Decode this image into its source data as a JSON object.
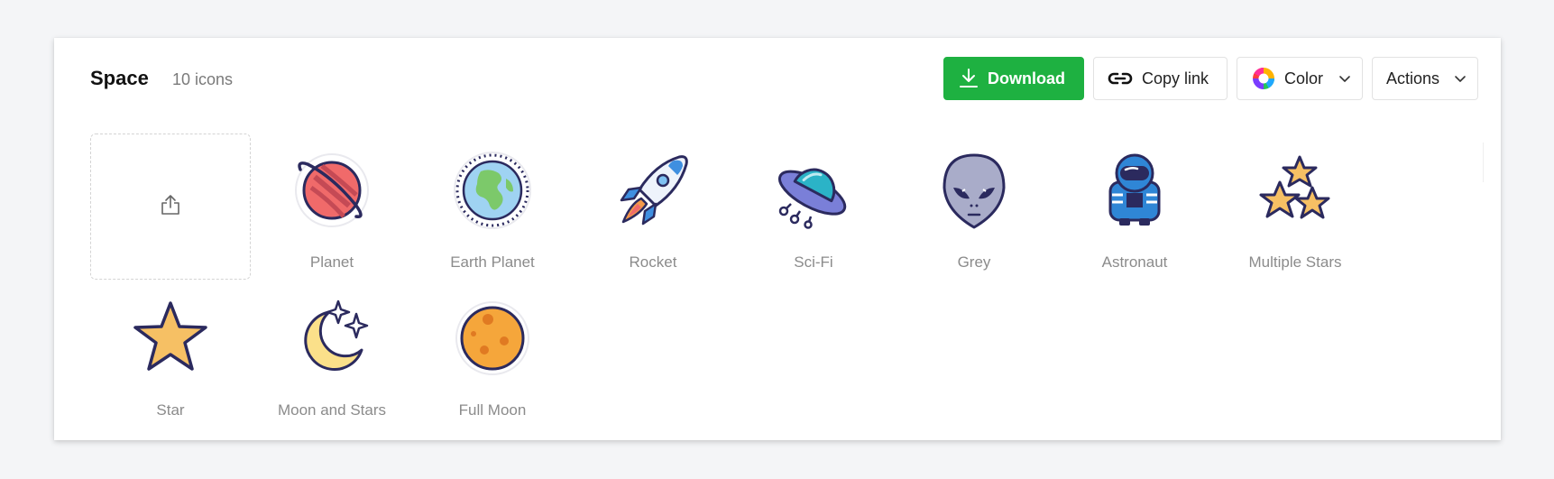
{
  "collection": {
    "title": "Space",
    "count": "10 icons"
  },
  "toolbar": {
    "download_label": "Download",
    "copy_link_label": "Copy link",
    "color_label": "Color",
    "actions_label": "Actions"
  },
  "icons": [
    {
      "label": "Planet",
      "icon": "planet-icon"
    },
    {
      "label": "Earth Planet",
      "icon": "earth-planet-icon"
    },
    {
      "label": "Rocket",
      "icon": "rocket-icon"
    },
    {
      "label": "Sci-Fi",
      "icon": "ufo-icon"
    },
    {
      "label": "Grey",
      "icon": "alien-icon"
    },
    {
      "label": "Astronaut",
      "icon": "astronaut-icon"
    },
    {
      "label": "Multiple Stars",
      "icon": "multiple-stars-icon"
    },
    {
      "label": "Star",
      "icon": "star-icon"
    },
    {
      "label": "Moon and Stars",
      "icon": "moon-and-stars-icon"
    },
    {
      "label": "Full Moon",
      "icon": "full-moon-icon"
    }
  ],
  "colors": {
    "download_green": "#1eb141",
    "label_grey": "#8b8b8b",
    "outline": "#2b2a5e"
  }
}
